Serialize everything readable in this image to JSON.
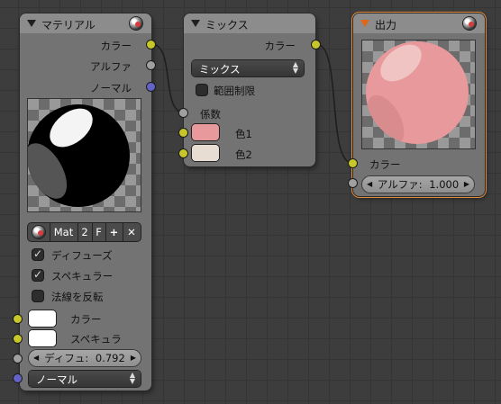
{
  "material_node": {
    "title": "マテリアル",
    "outputs": [
      "カラー",
      "アルファ",
      "ノーマル"
    ],
    "mat_selector": {
      "name": "Mat",
      "users": "2",
      "fake": "F",
      "add_icon": "plus-icon",
      "clear_icon": "x-icon"
    },
    "checkboxes": [
      {
        "label": "ディフューズ",
        "checked": true
      },
      {
        "label": "スペキュラー",
        "checked": true
      },
      {
        "label": "法線を反転",
        "checked": false
      }
    ],
    "inputs": [
      {
        "label": "カラー",
        "color": "#ffffff"
      },
      {
        "label": "スペキュラ",
        "color": "#ffffff"
      }
    ],
    "diffuse_field": {
      "label": "ディフュ:",
      "value": "0.792"
    },
    "normal_dropdown": "ノーマル"
  },
  "mix_node": {
    "title": "ミックス",
    "output": "カラー",
    "blend_mode": "ミックス",
    "clamp": {
      "label": "範囲制限",
      "checked": false
    },
    "factor_label": "係数",
    "color_inputs": [
      {
        "label": "色1",
        "color": "#e8999b"
      },
      {
        "label": "色2",
        "color": "#e8ddd2"
      }
    ]
  },
  "output_node": {
    "title": "出力",
    "input_label": "カラー",
    "alpha_field": {
      "label": "アルファ:",
      "value": "1.000"
    }
  },
  "colors": {
    "socket_color": "#c7c729",
    "socket_value": "#a0a0a0",
    "socket_vector": "#6363c7",
    "active_border": "#e08b36",
    "node_body": "#737373",
    "output_sphere": "#e8999b"
  }
}
